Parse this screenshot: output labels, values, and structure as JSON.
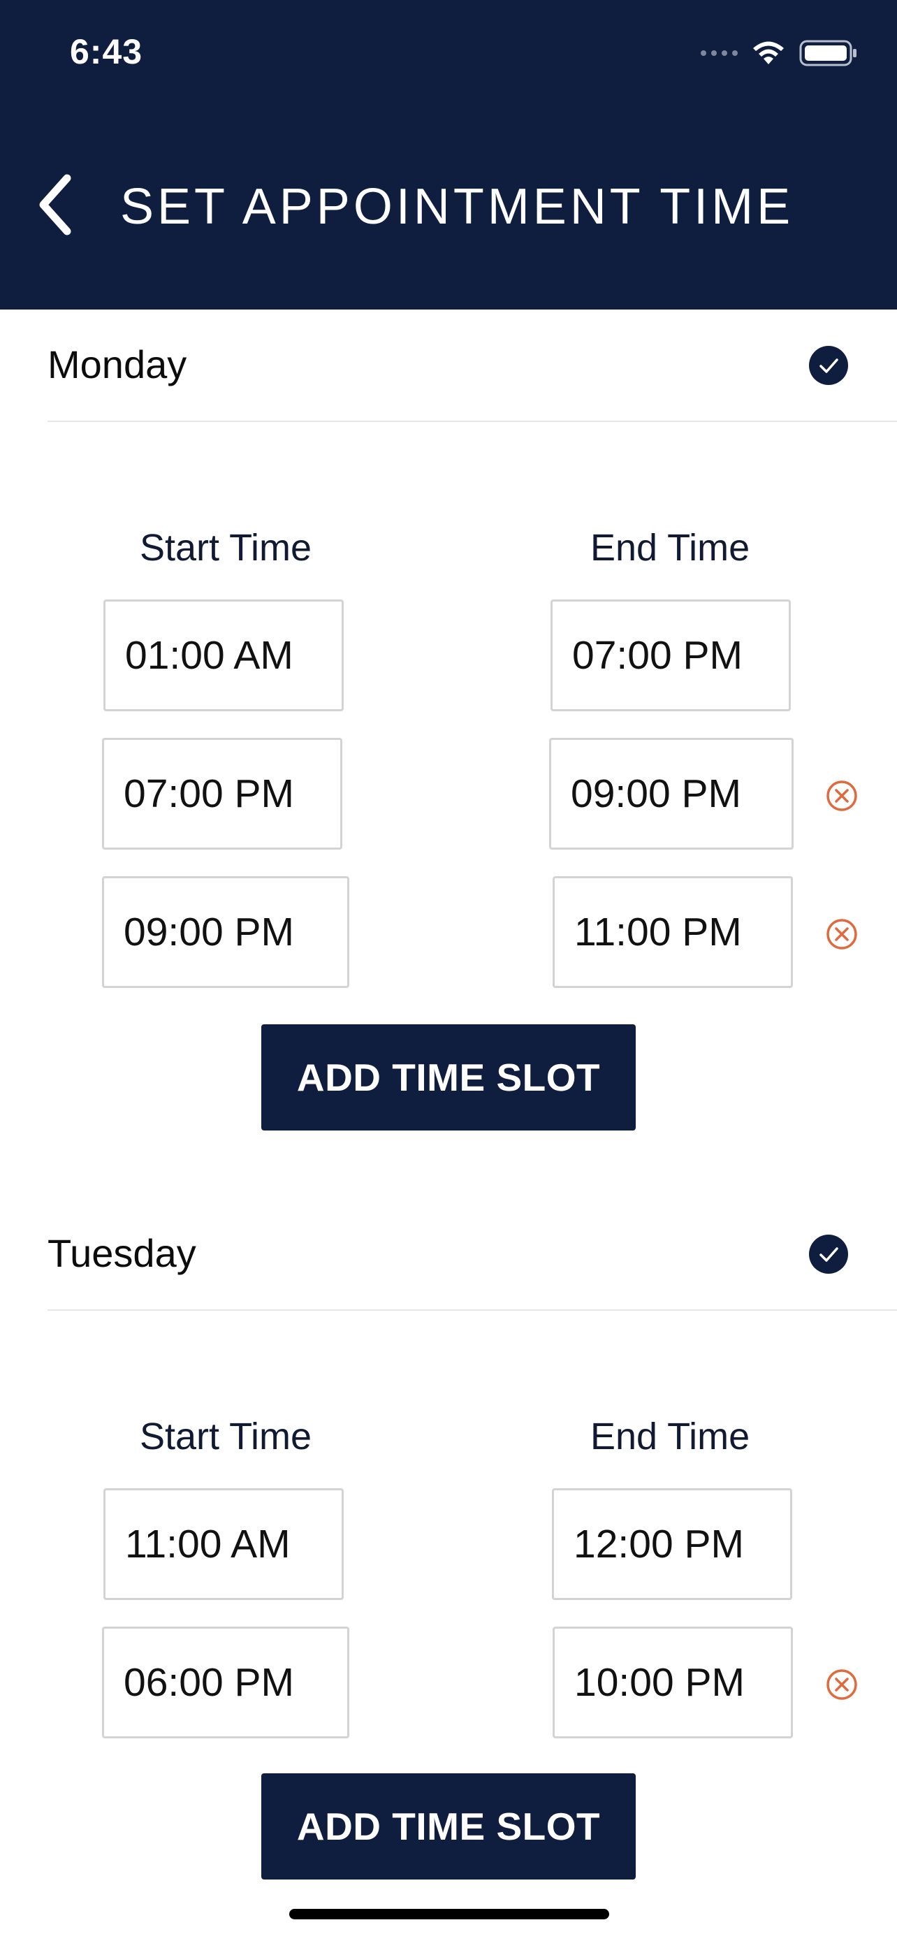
{
  "status_bar": {
    "time": "6:43",
    "signal_icon": "signal-dots-icon",
    "wifi_icon": "wifi-icon",
    "battery_icon": "battery-icon"
  },
  "header": {
    "title": "SET APPOINTMENT TIME",
    "back_icon": "chevron-left-icon",
    "background_color": "#0f1d3f"
  },
  "days": [
    {
      "name": "Monday",
      "checked": true,
      "start_label": "Start Time",
      "end_label": "End Time",
      "slots": [
        {
          "start": "01:00 AM",
          "end": "07:00 PM",
          "removable": false
        },
        {
          "start": "07:00 PM",
          "end": "09:00 PM",
          "removable": true
        },
        {
          "start": "09:00 PM",
          "end": "11:00 PM",
          "removable": true
        }
      ],
      "add_button_label": "ADD TIME SLOT"
    },
    {
      "name": "Tuesday",
      "checked": true,
      "start_label": "Start Time",
      "end_label": "End Time",
      "slots": [
        {
          "start": "11:00 AM",
          "end": "12:00 PM",
          "removable": false
        },
        {
          "start": "06:00 PM",
          "end": "10:00 PM",
          "removable": true
        }
      ],
      "add_button_label": "ADD TIME SLOT"
    }
  ],
  "colors": {
    "navy": "#0f1d3f",
    "remove_accent": "#e06a3d",
    "divider": "#e6e6e6",
    "field_border": "#d3d3d3"
  }
}
